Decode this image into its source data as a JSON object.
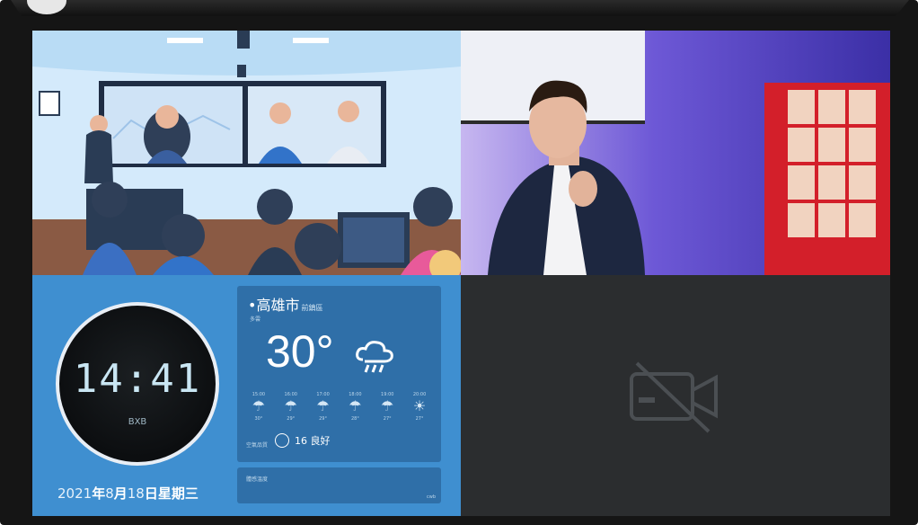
{
  "clock": {
    "time": "14:41",
    "subtitle": "BXB"
  },
  "date": {
    "year": "2021",
    "year_char": "年",
    "month": "8",
    "month_char": "月",
    "day": "18",
    "day_char": "日",
    "weekday": "星期三"
  },
  "weather": {
    "city": "高雄市",
    "district": "前鎮區",
    "sub": "多雲",
    "temperature": "30°",
    "forecast": [
      {
        "time": "15:00",
        "temp": "30°"
      },
      {
        "time": "16:00",
        "temp": "29°"
      },
      {
        "time": "17:00",
        "temp": "29°"
      },
      {
        "time": "18:00",
        "temp": "28°"
      },
      {
        "time": "19:00",
        "temp": "27°"
      },
      {
        "time": "20:00",
        "temp": "27°"
      }
    ],
    "aqi_label": "空氣品質",
    "aqi": "16 良好",
    "extra_label": "體感溫度",
    "extra_mark": "cwb"
  },
  "icons": {
    "camera_off": "video-camera-off-icon",
    "location": "location-pin-icon",
    "rain": "rain-cloud-icon"
  }
}
